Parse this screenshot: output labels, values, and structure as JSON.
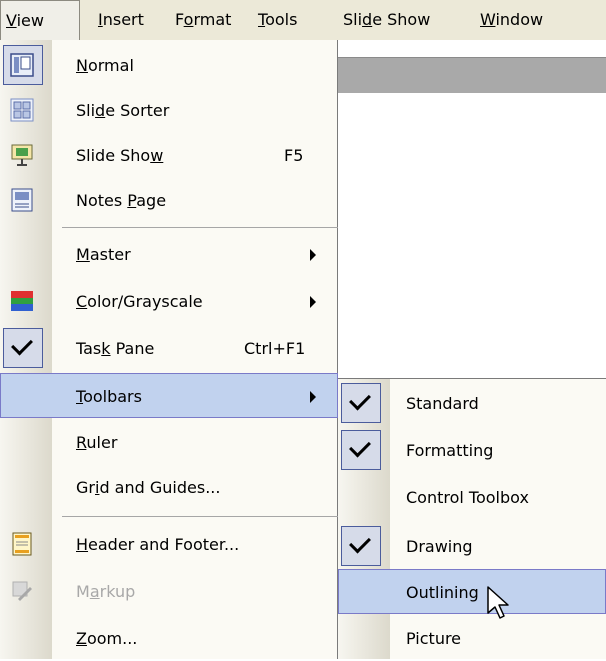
{
  "menubar": {
    "items": [
      {
        "label": "View",
        "mnemonic": "V",
        "rest": "iew"
      },
      {
        "label": "Insert",
        "mnemonic": "I",
        "rest": "nsert"
      },
      {
        "label": "Format",
        "pre": "F",
        "mnemonic": "o",
        "rest": "rmat"
      },
      {
        "label": "Tools",
        "mnemonic": "T",
        "rest": "ools"
      },
      {
        "label": "Slide Show",
        "pre": "Sli",
        "mnemonic": "d",
        "rest": "e Show"
      },
      {
        "label": "Window",
        "mnemonic": "W",
        "rest": "indow"
      }
    ]
  },
  "view_menu": {
    "items": [
      {
        "pre": "",
        "mnemonic": "N",
        "rest": "ormal",
        "shortcut": "",
        "icon": "normal-view-icon"
      },
      {
        "pre": "Sli",
        "mnemonic": "d",
        "rest": "e Sorter",
        "shortcut": "",
        "icon": "slide-sorter-icon"
      },
      {
        "pre": "Slide Sho",
        "mnemonic": "w",
        "rest": "",
        "shortcut": "F5",
        "icon": "slide-show-icon"
      },
      {
        "pre": "Notes ",
        "mnemonic": "P",
        "rest": "age",
        "shortcut": "",
        "icon": "notes-page-icon"
      },
      {
        "pre": "",
        "mnemonic": "M",
        "rest": "aster",
        "shortcut": "",
        "submenu": true
      },
      {
        "pre": "",
        "mnemonic": "C",
        "rest": "olor/Grayscale",
        "shortcut": "",
        "submenu": true,
        "icon": "color-grayscale-icon"
      },
      {
        "pre": "Tas",
        "mnemonic": "k",
        "rest": " Pane",
        "shortcut": "Ctrl+F1",
        "checked": true
      },
      {
        "pre": "",
        "mnemonic": "T",
        "rest": "oolbars",
        "shortcut": "",
        "submenu": true,
        "highlighted": true
      },
      {
        "pre": "",
        "mnemonic": "R",
        "rest": "uler",
        "shortcut": ""
      },
      {
        "pre": "Gr",
        "mnemonic": "i",
        "rest": "d and Guides...",
        "shortcut": ""
      },
      {
        "pre": "",
        "mnemonic": "H",
        "rest": "eader and Footer...",
        "shortcut": "",
        "icon": "header-footer-icon"
      },
      {
        "pre": "M",
        "mnemonic": "a",
        "rest": "rkup",
        "shortcut": "",
        "disabled": true,
        "icon": "markup-icon"
      },
      {
        "pre": "",
        "mnemonic": "Z",
        "rest": "oom...",
        "shortcut": ""
      }
    ]
  },
  "toolbars_submenu": {
    "items": [
      {
        "label": "Standard",
        "checked": true
      },
      {
        "label": "Formatting",
        "checked": true
      },
      {
        "label": "Control Toolbox",
        "checked": false
      },
      {
        "label": "Drawing",
        "checked": true
      },
      {
        "label": "Outlining",
        "checked": false,
        "highlighted": true
      },
      {
        "label": "Picture",
        "checked": false
      }
    ]
  },
  "colors": {
    "highlight": "#c1d2ee",
    "highlight_border": "#7a7ac8",
    "menubar": "#ece9d8",
    "disabled_text": "#a8a8a8"
  }
}
